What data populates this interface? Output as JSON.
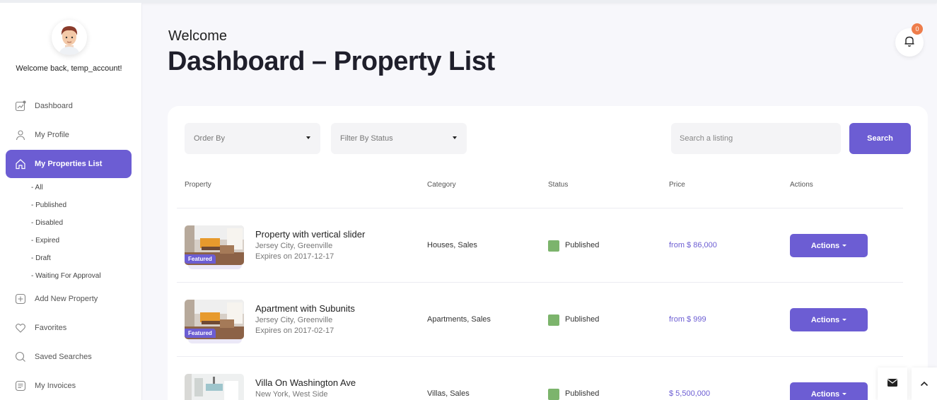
{
  "sidebar": {
    "welcome_text": "Welcome back, temp_account!",
    "nav": [
      {
        "label": "Dashboard",
        "icon": "chart-icon"
      },
      {
        "label": "My Profile",
        "icon": "user-icon"
      },
      {
        "label": "My Properties List",
        "icon": "home-icon",
        "active": true
      },
      {
        "label": "Add New Property",
        "icon": "plus-square-icon"
      },
      {
        "label": "Favorites",
        "icon": "heart-icon"
      },
      {
        "label": "Saved Searches",
        "icon": "search-icon"
      },
      {
        "label": "My Invoices",
        "icon": "invoice-icon"
      }
    ],
    "sub_items": [
      "- All",
      "- Published",
      "- Disabled",
      "- Expired",
      "- Draft",
      "- Waiting For Approval"
    ]
  },
  "header": {
    "welcome": "Welcome",
    "title": "Dashboard – Property List",
    "notification_count": "0"
  },
  "filters": {
    "order_by": "Order By",
    "filter_status": "Filter By Status",
    "search_placeholder": "Search a listing",
    "search_button": "Search"
  },
  "table": {
    "headers": [
      "Property",
      "Category",
      "Status",
      "Price",
      "Actions"
    ],
    "rows": [
      {
        "title": "Property with vertical slider",
        "location": "Jersey City, Greenville",
        "expires": "Expires on 2017-12-17",
        "category": "Houses, Sales",
        "status": "Published",
        "price": "from $ 86,000",
        "action": "Actions",
        "featured": "Featured"
      },
      {
        "title": "Apartment with Subunits",
        "location": "Jersey City, Greenville",
        "expires": "Expires on 2017-02-17",
        "category": "Apartments, Sales",
        "status": "Published",
        "price": "from $ 999",
        "action": "Actions",
        "featured": "Featured"
      },
      {
        "title": "Villa On Washington Ave",
        "location": "New York, West Side",
        "category": "Villas, Sales",
        "status": "Published",
        "price": "$ 5,500,000",
        "action": "Actions"
      }
    ]
  },
  "colors": {
    "accent": "#6c5dd3",
    "status_published": "#7cb46c",
    "badge": "#ee7d4b"
  }
}
